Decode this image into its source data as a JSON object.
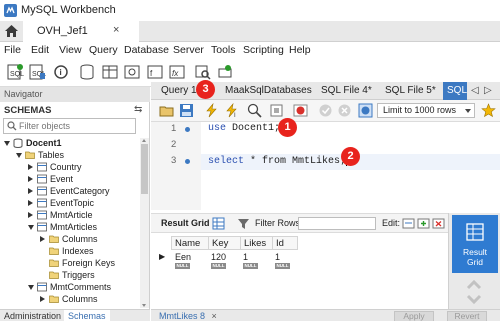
{
  "window": {
    "title": "MySQL Workbench"
  },
  "connection_tab": {
    "label": "OVH_Jef1",
    "close": "×"
  },
  "menu": [
    "File",
    "Edit",
    "View",
    "Query",
    "Database",
    "Server",
    "Tools",
    "Scripting",
    "Help"
  ],
  "navigator": {
    "header": "Navigator",
    "schemas_title": "SCHEMAS",
    "refresh_glyph": "⇆",
    "filter_placeholder": "Filter objects",
    "tree": [
      {
        "label": "Docent1",
        "expanded": true,
        "type": "schema",
        "bold": true
      },
      {
        "label": "Tables",
        "expanded": true,
        "type": "folder"
      },
      {
        "label": "Country",
        "expanded": false,
        "type": "table"
      },
      {
        "label": "Event",
        "expanded": false,
        "type": "table"
      },
      {
        "label": "EventCategory",
        "expanded": false,
        "type": "table"
      },
      {
        "label": "EventTopic",
        "expanded": false,
        "type": "table"
      },
      {
        "label": "MmtArticle",
        "expanded": false,
        "type": "table"
      },
      {
        "label": "MmtArticles",
        "expanded": true,
        "type": "table"
      },
      {
        "label": "Columns",
        "expanded": false,
        "type": "subfolder"
      },
      {
        "label": "Indexes",
        "expanded": null,
        "type": "subfolder"
      },
      {
        "label": "Foreign Keys",
        "expanded": null,
        "type": "subfolder"
      },
      {
        "label": "Triggers",
        "expanded": null,
        "type": "subfolder"
      },
      {
        "label": "MmtComments",
        "expanded": true,
        "type": "table"
      },
      {
        "label": "Columns",
        "expanded": false,
        "type": "subfolder"
      }
    ],
    "bottom_tabs": [
      "Administration",
      "Schemas"
    ]
  },
  "editor_tabs": [
    {
      "label": "Query 1",
      "active": false
    },
    {
      "label": "MaakSqlDatabases",
      "active": false
    },
    {
      "label": "SQL File 4*",
      "active": false
    },
    {
      "label": "SQL File 5*",
      "active": false
    },
    {
      "label": "SQL",
      "active": true
    }
  ],
  "editor_toolbar": {
    "limit_label": "Limit to 1000 rows"
  },
  "editor": {
    "lines": [
      {
        "no": "1",
        "code_kw": "use",
        "code_rest": " Docent1;"
      },
      {
        "no": "2",
        "code_kw": "",
        "code_rest": ""
      },
      {
        "no": "3",
        "code_kw": "select",
        "code_rest": " * from MmtLikes;"
      }
    ]
  },
  "callouts": [
    "1",
    "2",
    "3"
  ],
  "result": {
    "grid_label": "Result Grid",
    "filter_label": "Filter Rows:",
    "edit_label": "Edit:",
    "columns": [
      "Name",
      "Key",
      "Likes",
      "Id"
    ],
    "rows": [
      [
        "Een",
        "120",
        "1",
        "1"
      ]
    ],
    "null_label": "NULL",
    "panel_label_1": "Result",
    "panel_label_2": "Grid"
  },
  "bottom": {
    "result_tab": "MmtLikes 8",
    "close": "×",
    "apply": "Apply",
    "revert": "Revert"
  },
  "colors": {
    "accent": "#3c79c2",
    "callout": "#e8231d",
    "result_grid_btn": "#2f7bd1"
  }
}
